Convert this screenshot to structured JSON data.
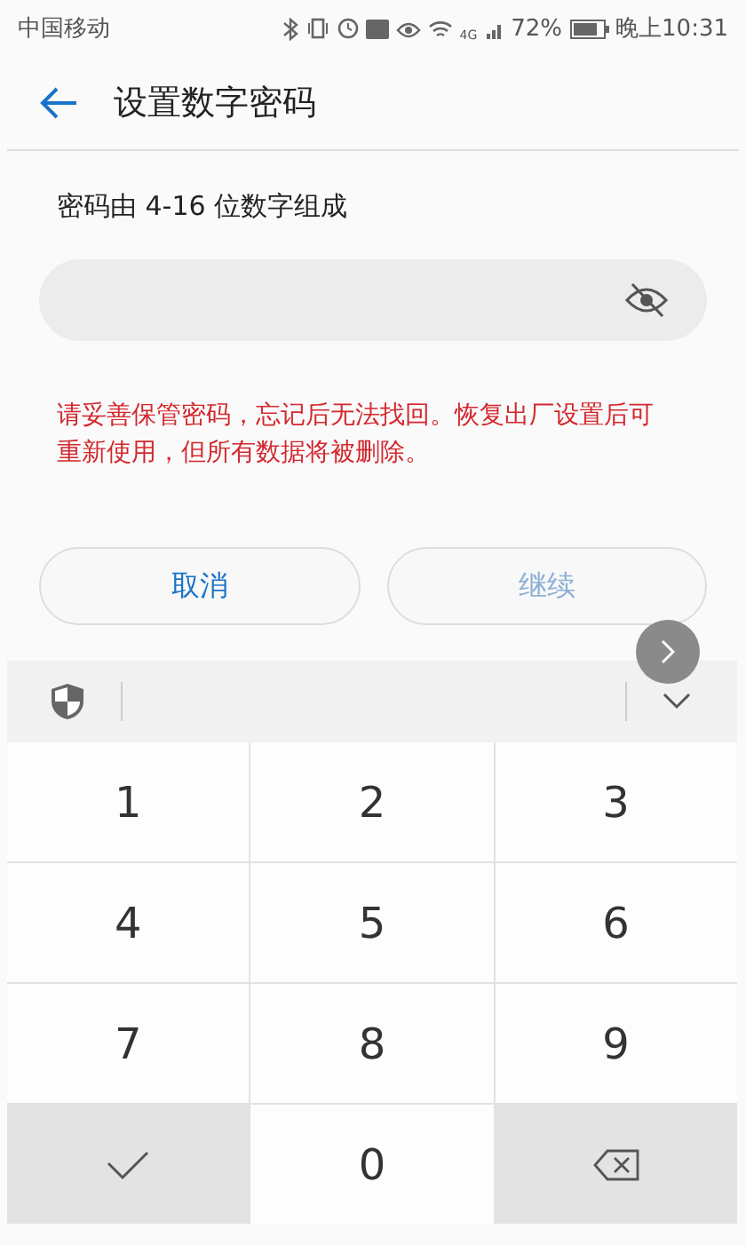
{
  "status_bar": {
    "carrier": "中国移动",
    "network": "4G",
    "battery": "72%",
    "time": "晚上10:31"
  },
  "header": {
    "title": "设置数字密码"
  },
  "description": "密码由 4-16 位数字组成",
  "password_field": {
    "masked": true
  },
  "warning": "请妥善保管密码，忘记后无法找回。恢复出厂设置后可重新使用，但所有数据将被删除。",
  "buttons": [
    {
      "label": "取消",
      "disabled": false
    },
    {
      "label": "继续",
      "disabled": true
    }
  ],
  "keyboard": {
    "keys": [
      {
        "kind": "digit",
        "label": "1"
      },
      {
        "kind": "digit",
        "label": "2"
      },
      {
        "kind": "digit",
        "label": "3"
      },
      {
        "kind": "digit",
        "label": "4"
      },
      {
        "kind": "digit",
        "label": "5"
      },
      {
        "kind": "digit",
        "label": "6"
      },
      {
        "kind": "digit",
        "label": "7"
      },
      {
        "kind": "digit",
        "label": "8"
      },
      {
        "kind": "digit",
        "label": "9"
      },
      {
        "kind": "confirm"
      },
      {
        "kind": "digit",
        "label": "0"
      },
      {
        "kind": "delete"
      }
    ]
  }
}
